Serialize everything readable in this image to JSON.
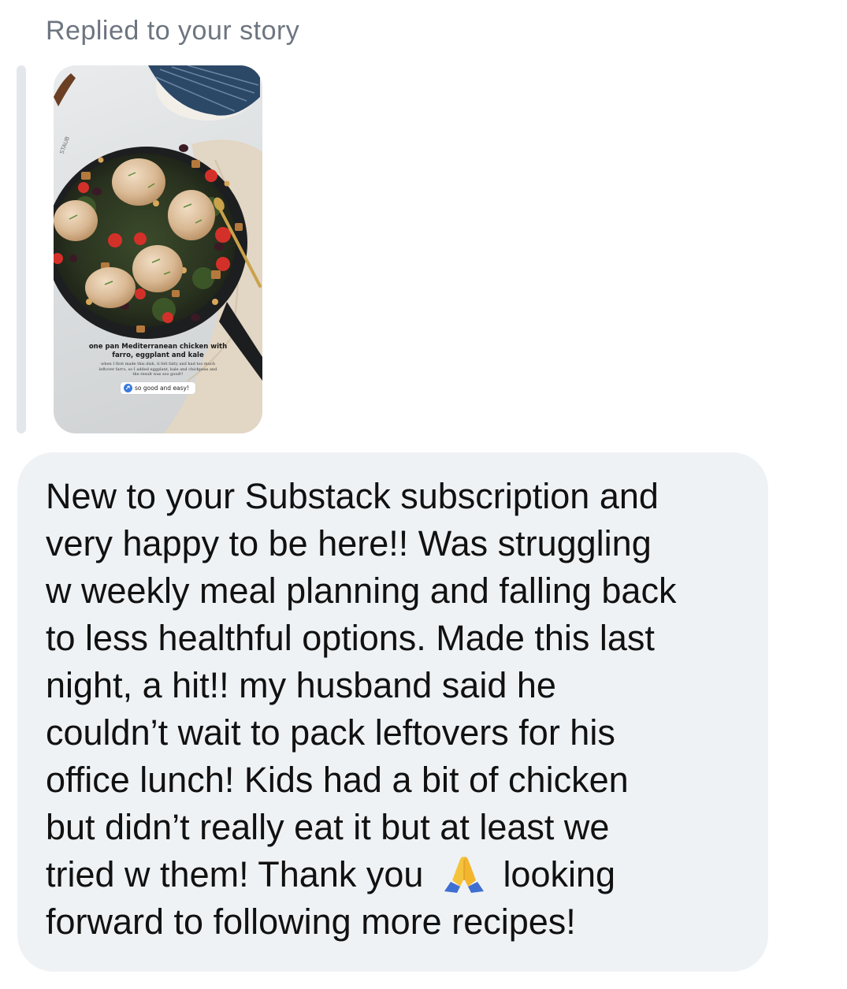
{
  "reply": {
    "label": "Replied to your story"
  },
  "story": {
    "pan_brand": "STAUB",
    "title_line1": "one pan Mediterranean chicken with",
    "title_line2": "farro, eggplant and kale",
    "body": "when I first made this dish, it felt fatty and had too much leftover farro, so I added eggplant, kale and chickpeas and the result was soo good!!",
    "link_label": "so good and easy!",
    "link_icon": "link-icon"
  },
  "message": {
    "lines": [
      "New to your Substack subscription and",
      "very happy to be here!! Was struggling",
      "w weekly meal planning and falling back",
      "to less healthful options. Made this last",
      "night, a hit!! my husband said he",
      "couldn’t wait to pack leftovers for his",
      "office lunch! Kids had a bit of chicken",
      "but didn’t really eat it but at least we"
    ],
    "line9_before_emoji": "tried w them! Thank you",
    "emoji": "folded-hands-emoji",
    "line9_after_emoji": "looking",
    "line10": "forward to following more recipes!"
  },
  "colors": {
    "bubble": "#eff2f5",
    "text": "#111111",
    "label": "#6d7580",
    "reply_bar": "#e3e7ec"
  }
}
